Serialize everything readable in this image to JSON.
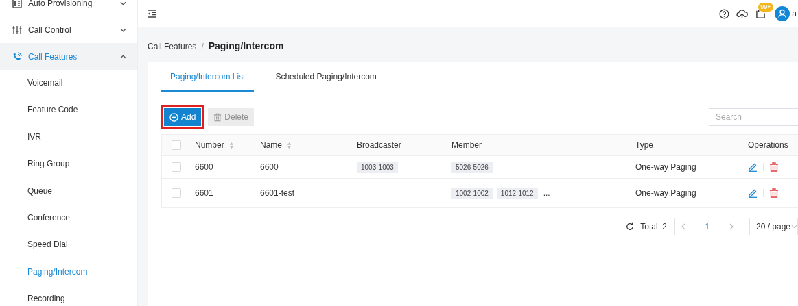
{
  "sidebar": {
    "items": [
      {
        "label": "Auto Provisioning",
        "expanded": false,
        "selected": false
      },
      {
        "label": "Call Control",
        "expanded": false,
        "selected": false
      },
      {
        "label": "Call Features",
        "expanded": true,
        "selected": true,
        "children": [
          {
            "label": "Voicemail",
            "selected": false
          },
          {
            "label": "Feature Code",
            "selected": false
          },
          {
            "label": "IVR",
            "selected": false
          },
          {
            "label": "Ring Group",
            "selected": false
          },
          {
            "label": "Queue",
            "selected": false
          },
          {
            "label": "Conference",
            "selected": false
          },
          {
            "label": "Speed Dial",
            "selected": false
          },
          {
            "label": "Paging/Intercom",
            "selected": true
          },
          {
            "label": "Recording",
            "selected": false
          }
        ]
      }
    ]
  },
  "header": {
    "notification_badge": "99+",
    "user": "a"
  },
  "breadcrumb": {
    "parent": "Call Features",
    "separator": "/",
    "current": "Paging/Intercom"
  },
  "tabs": [
    {
      "label": "Paging/Intercom List",
      "selected": true
    },
    {
      "label": "Scheduled Paging/Intercom",
      "selected": false
    }
  ],
  "toolbar": {
    "add": {
      "label": "Add",
      "highlighted": true,
      "disabled": false
    },
    "delete": {
      "label": "Delete",
      "disabled": true
    },
    "search": {
      "placeholder": "Search"
    }
  },
  "table": {
    "columns": [
      {
        "label": "Number",
        "sortable": true
      },
      {
        "label": "Name",
        "sortable": true
      },
      {
        "label": "Broadcaster",
        "sortable": false
      },
      {
        "label": "Member",
        "sortable": false
      },
      {
        "label": "Type",
        "sortable": false
      },
      {
        "label": "Operations",
        "sortable": false
      }
    ],
    "header_checked": false,
    "rows": [
      {
        "checked": false,
        "number": "6600",
        "name": "6600",
        "broadcaster": [
          "1003-1003"
        ],
        "member": [
          "5026-5026"
        ],
        "member_more": "",
        "type": "One-way Paging"
      },
      {
        "checked": false,
        "number": "6601",
        "name": "6601-test",
        "broadcaster": [],
        "member": [
          "1002-1002",
          "1012-1012"
        ],
        "member_more": "...",
        "type": "One-way Paging"
      }
    ]
  },
  "pagination": {
    "total": "Total :2",
    "pages": [
      {
        "label": "1",
        "selected": true
      }
    ],
    "page_size": "20 / page"
  }
}
